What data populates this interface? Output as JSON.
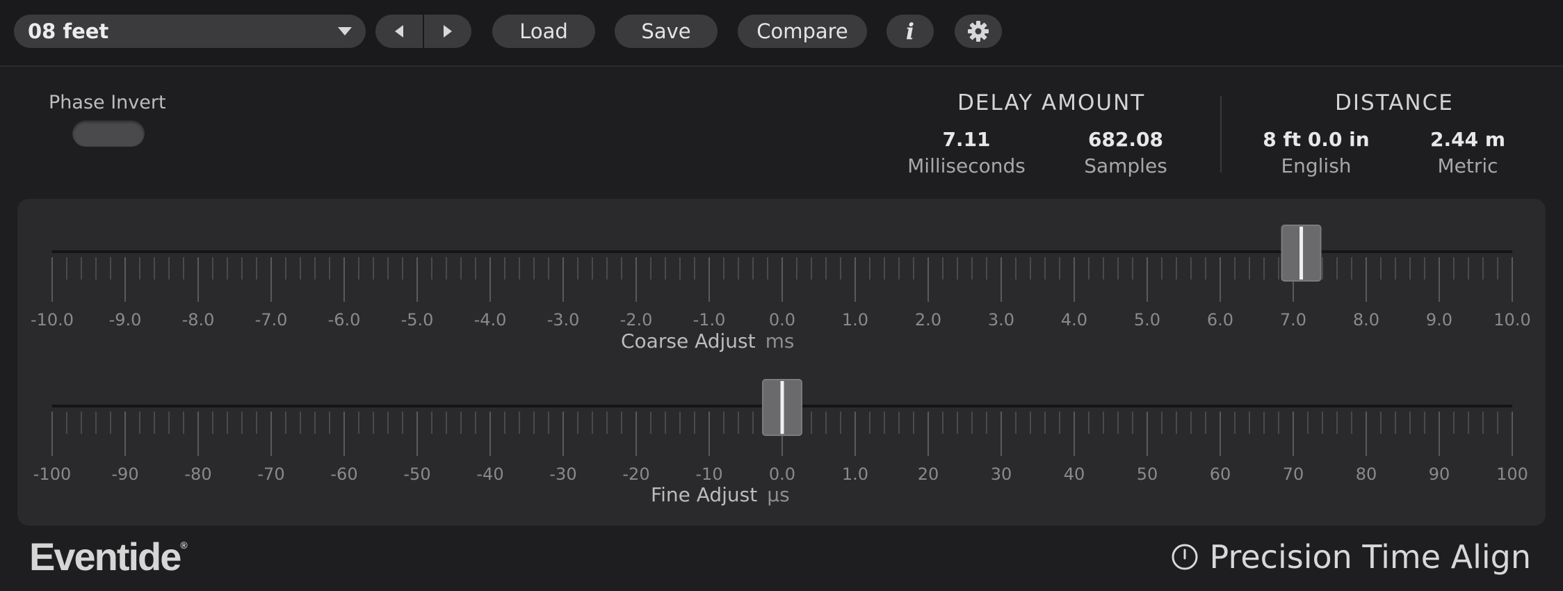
{
  "toolbar": {
    "preset_name": "08 feet",
    "load_label": "Load",
    "save_label": "Save",
    "compare_label": "Compare",
    "info_label": "i"
  },
  "phase_invert": {
    "label": "Phase Invert",
    "on": false
  },
  "delay": {
    "title": "DELAY AMOUNT",
    "ms_value": "7.11",
    "ms_unit": "Milliseconds",
    "samples_value": "682.08",
    "samples_unit": "Samples"
  },
  "distance": {
    "title": "DISTANCE",
    "english_value": "8 ft 0.0 in",
    "english_unit": "English",
    "metric_value": "2.44 m",
    "metric_unit": "Metric"
  },
  "coarse": {
    "label": "Coarse Adjust",
    "unit": "ms",
    "value": 7.11,
    "min": -10,
    "max": 10,
    "ticks": [
      "-10.0",
      "-9.0",
      "-8.0",
      "-7.0",
      "-6.0",
      "-5.0",
      "-4.0",
      "-3.0",
      "-2.0",
      "-1.0",
      "0.0",
      "1.0",
      "2.0",
      "3.0",
      "4.0",
      "5.0",
      "6.0",
      "7.0",
      "8.0",
      "9.0",
      "10.0"
    ]
  },
  "fine": {
    "label": "Fine Adjust",
    "unit": "µs",
    "value": 0,
    "min": -100,
    "max": 100,
    "ticks": [
      "-100",
      "-90",
      "-80",
      "-70",
      "-60",
      "-50",
      "-40",
      "-30",
      "-20",
      "-10",
      "0.0",
      "1.0",
      "20",
      "30",
      "40",
      "50",
      "60",
      "70",
      "80",
      "90",
      "100"
    ]
  },
  "footer": {
    "brand": "Eventide",
    "brand_mark": "®",
    "product": "Precision Time Align"
  },
  "colors": {
    "background": "#1e1e20",
    "panel": "#2a2a2c",
    "button": "#3b3b3e",
    "thumb": "#6a6a6d"
  }
}
